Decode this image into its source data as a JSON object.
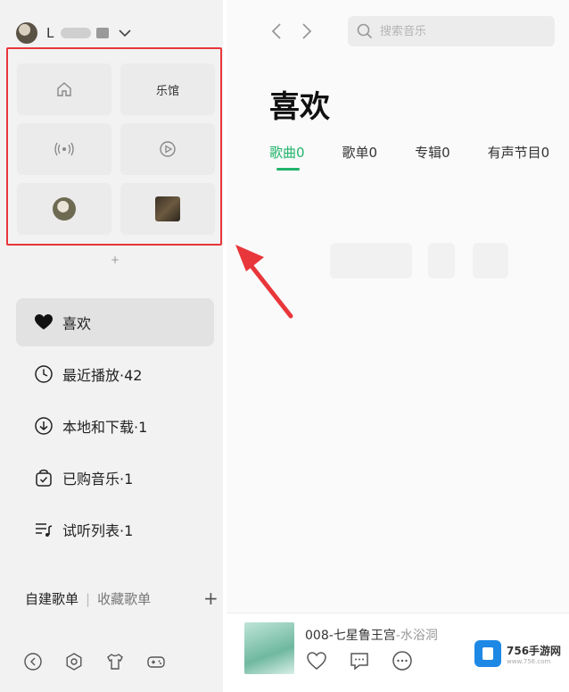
{
  "sidebar": {
    "user": {
      "name": "L"
    },
    "quick_tiles": [
      {
        "name": "home",
        "label": ""
      },
      {
        "name": "music-hall",
        "label": "乐馆"
      },
      {
        "name": "radio",
        "label": ""
      },
      {
        "name": "video",
        "label": ""
      },
      {
        "name": "singer",
        "label": ""
      },
      {
        "name": "album",
        "label": ""
      }
    ],
    "pin_symbol": "+",
    "nav": [
      {
        "label": "喜欢",
        "icon": "heart-icon",
        "active": true
      },
      {
        "label": "最近播放·42",
        "icon": "clock-icon"
      },
      {
        "label": "本地和下载·1",
        "icon": "download-icon"
      },
      {
        "label": "已购音乐·1",
        "icon": "shopping-bag-icon"
      },
      {
        "label": "试听列表·1",
        "icon": "playlist-icon"
      }
    ],
    "playlists": {
      "created": "自建歌单",
      "separator": "|",
      "collected": "收藏歌单",
      "add": "+"
    },
    "bottom_icons": [
      "back-circle-icon",
      "settings-icon",
      "skin-icon",
      "game-icon"
    ]
  },
  "main": {
    "search": {
      "placeholder": "搜索音乐"
    },
    "title": "喜欢",
    "tabs": [
      {
        "label": "歌曲0",
        "active": true
      },
      {
        "label": "歌单0"
      },
      {
        "label": "专辑0"
      },
      {
        "label": "有声节目0"
      }
    ]
  },
  "player": {
    "track": "008-七星鲁王宫",
    "artist": "-水浴洞"
  },
  "watermark": {
    "brand": "756手游网",
    "sub": "www.756.com"
  },
  "colors": {
    "accent": "#22b36b",
    "highlight_border": "#e8363a"
  }
}
